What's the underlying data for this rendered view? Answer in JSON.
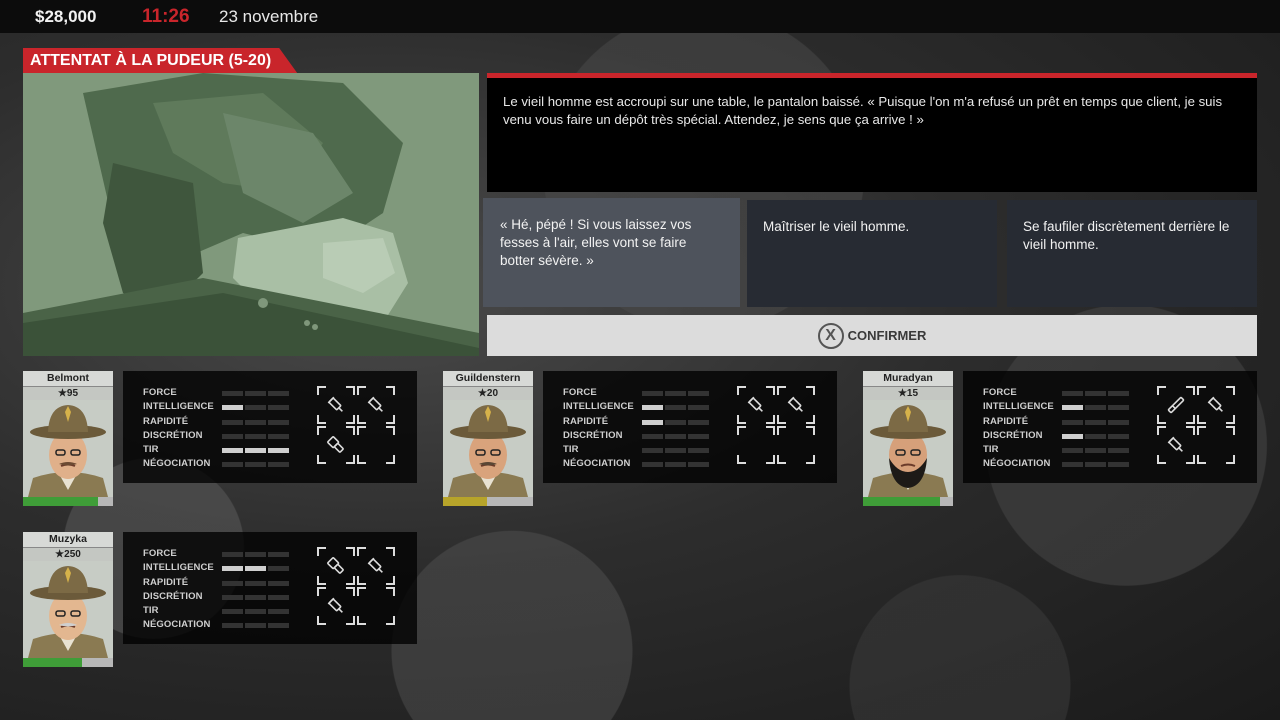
{
  "hud": {
    "money": "$28,000",
    "time": "11:26",
    "date": "23 novembre"
  },
  "event": {
    "title": "ATTENTAT À LA PUDEUR (5-20)",
    "description": "Le vieil homme est accroupi sur une table, le pantalon baissé. « Puisque l'on m'a refusé un prêt en temps que client, je suis venu vous faire un dépôt très spécial. Attendez, je sens que ça arrive ! »"
  },
  "choices": [
    {
      "text": "« Hé, pépé ! Si vous laissez vos fesses à l'air, elles vont se faire botter sévère. »",
      "selected": true
    },
    {
      "text": "Maîtriser le vieil homme.",
      "selected": false
    },
    {
      "text": "Se faufiler discrètement derrière le vieil homme.",
      "selected": false
    }
  ],
  "confirm": {
    "icon": "x-button-icon",
    "label": "CONFIRMER"
  },
  "stat_labels": [
    "FORCE",
    "INTELLIGENCE",
    "RAPIDITÉ",
    "DISCRÉTION",
    "TIR",
    "NÉGOCIATION"
  ],
  "agents": [
    {
      "name": "Belmont",
      "rank": "★95",
      "health": 0.83,
      "health_color": "#3f9d38",
      "stats": [
        0,
        1,
        0,
        0,
        3,
        0
      ],
      "items": [
        "syringe-icon",
        "syringe-icon",
        "stun-gun-icon",
        "empty-slot"
      ]
    },
    {
      "name": "Guildenstern",
      "rank": "★20",
      "health": 0.49,
      "health_color": "#b7a42a",
      "stats": [
        0,
        1,
        1,
        0,
        0,
        0
      ],
      "items": [
        "syringe-icon",
        "syringe-icon",
        "empty-slot",
        "empty-slot"
      ]
    },
    {
      "name": "Muradyan",
      "rank": "★15",
      "health": 0.85,
      "health_color": "#3f9d38",
      "stats": [
        0,
        1,
        0,
        1,
        0,
        0
      ],
      "items": [
        "baton-icon",
        "syringe-icon",
        "syringe-icon",
        "empty-slot"
      ]
    },
    {
      "name": "Muzyka",
      "rank": "★250",
      "health": 0.66,
      "health_color": "#3f9d38",
      "stats": [
        0,
        2,
        0,
        0,
        0,
        0
      ],
      "items": [
        "stun-gun-icon",
        "syringe-icon",
        "syringe-icon",
        "empty-slot"
      ]
    }
  ]
}
